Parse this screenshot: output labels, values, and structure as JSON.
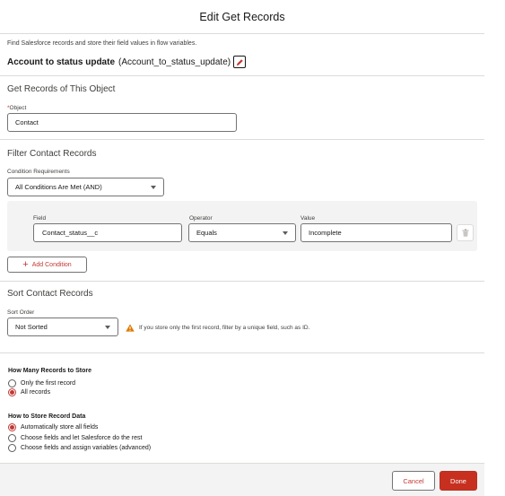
{
  "header": {
    "title": "Edit Get Records"
  },
  "intro": {
    "description": "Find Salesforce records and store their field values in flow variables.",
    "flow_label": "Account to status update",
    "flow_api_name": "(Account_to_status_update)",
    "edit_icon": "pencil-icon"
  },
  "object_section": {
    "title": "Get Records of This Object",
    "required_marker": "*",
    "field_label": "Object",
    "value": "Contact"
  },
  "filter_section": {
    "title": "Filter Contact Records",
    "requirements_label": "Condition Requirements",
    "requirements_value": "All Conditions Are Met (AND)",
    "columns": {
      "field": "Field",
      "operator": "Operator",
      "value": "Value"
    },
    "condition": {
      "field": "Contact_status__c",
      "operator": "Equals",
      "value": "Incomplete"
    },
    "add_condition_label": "Add Condition",
    "delete_icon": "trash-icon"
  },
  "sort_section": {
    "title": "Sort Contact Records",
    "order_label": "Sort Order",
    "order_value": "Not Sorted",
    "warning_icon": "warning-icon",
    "warning_text": "If you store only the first record, filter by a unique field, such as ID."
  },
  "store_count": {
    "title": "How Many Records to Store",
    "options": [
      {
        "label": "Only the first record",
        "checked": false
      },
      {
        "label": "All records",
        "checked": true
      }
    ]
  },
  "store_data": {
    "title": "How to Store Record Data",
    "options": [
      {
        "label": "Automatically store all fields",
        "checked": true
      },
      {
        "label": "Choose fields and let Salesforce do the rest",
        "checked": false
      },
      {
        "label": "Choose fields and assign variables (advanced)",
        "checked": false
      }
    ]
  },
  "footer": {
    "cancel_label": "Cancel",
    "done_label": "Done"
  },
  "colors": {
    "brand": "#c7301f",
    "border": "#dddbda",
    "panel": "#f3f3f3"
  }
}
